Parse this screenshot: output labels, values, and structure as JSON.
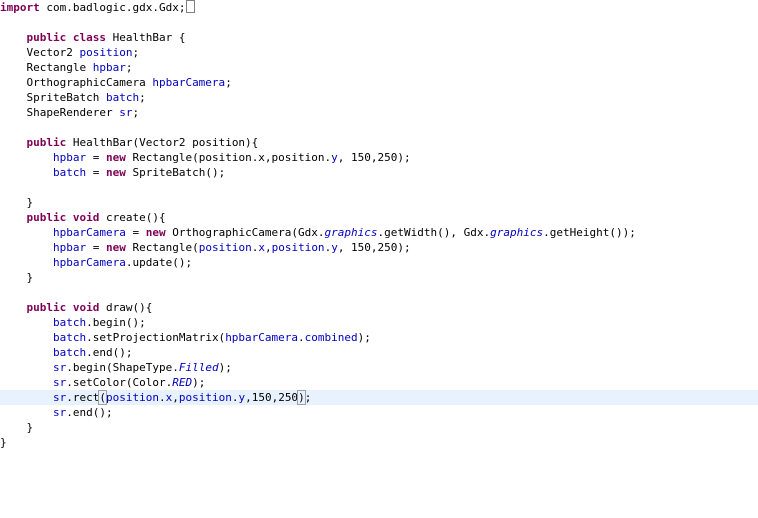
{
  "editor": {
    "current_line_index": 26,
    "lines": [
      [
        {
          "t": "kw",
          "v": "import"
        },
        {
          "t": "plain",
          "v": " com.badlogic.gdx.Gdx;"
        },
        {
          "t": "caret",
          "v": ""
        }
      ],
      [],
      [
        {
          "t": "plain",
          "v": "    "
        },
        {
          "t": "kw",
          "v": "public"
        },
        {
          "t": "plain",
          "v": " "
        },
        {
          "t": "kw",
          "v": "class"
        },
        {
          "t": "plain",
          "v": " HealthBar {"
        }
      ],
      [
        {
          "t": "plain",
          "v": "    Vector2 "
        },
        {
          "t": "field",
          "v": "position"
        },
        {
          "t": "plain",
          "v": ";"
        }
      ],
      [
        {
          "t": "plain",
          "v": "    Rectangle "
        },
        {
          "t": "field",
          "v": "hpbar"
        },
        {
          "t": "plain",
          "v": ";"
        }
      ],
      [
        {
          "t": "plain",
          "v": "    OrthographicCamera "
        },
        {
          "t": "field",
          "v": "hpbarCamera"
        },
        {
          "t": "plain",
          "v": ";"
        }
      ],
      [
        {
          "t": "plain",
          "v": "    SpriteBatch "
        },
        {
          "t": "field",
          "v": "batch"
        },
        {
          "t": "plain",
          "v": ";"
        }
      ],
      [
        {
          "t": "plain",
          "v": "    ShapeRenderer "
        },
        {
          "t": "field",
          "v": "sr"
        },
        {
          "t": "plain",
          "v": ";"
        }
      ],
      [],
      [
        {
          "t": "plain",
          "v": "    "
        },
        {
          "t": "kw",
          "v": "public"
        },
        {
          "t": "plain",
          "v": " HealthBar(Vector2 position){"
        }
      ],
      [
        {
          "t": "plain",
          "v": "        "
        },
        {
          "t": "field",
          "v": "hpbar"
        },
        {
          "t": "plain",
          "v": " = "
        },
        {
          "t": "kw",
          "v": "new"
        },
        {
          "t": "plain",
          "v": " Rectangle(position.x,position."
        },
        {
          "t": "field",
          "v": "y"
        },
        {
          "t": "plain",
          "v": ", 150,250);"
        }
      ],
      [
        {
          "t": "plain",
          "v": "        "
        },
        {
          "t": "field",
          "v": "batch"
        },
        {
          "t": "plain",
          "v": " = "
        },
        {
          "t": "kw",
          "v": "new"
        },
        {
          "t": "plain",
          "v": " SpriteBatch();"
        }
      ],
      [],
      [
        {
          "t": "plain",
          "v": "    }"
        }
      ],
      [
        {
          "t": "plain",
          "v": "    "
        },
        {
          "t": "kw",
          "v": "public"
        },
        {
          "t": "plain",
          "v": " "
        },
        {
          "t": "kw",
          "v": "void"
        },
        {
          "t": "plain",
          "v": " create(){"
        }
      ],
      [
        {
          "t": "plain",
          "v": "        "
        },
        {
          "t": "field",
          "v": "hpbarCamera"
        },
        {
          "t": "plain",
          "v": " = "
        },
        {
          "t": "kw",
          "v": "new"
        },
        {
          "t": "plain",
          "v": " OrthographicCamera(Gdx."
        },
        {
          "t": "static",
          "v": "graphics"
        },
        {
          "t": "plain",
          "v": ".getWidth(), Gdx."
        },
        {
          "t": "static",
          "v": "graphics"
        },
        {
          "t": "plain",
          "v": ".getHeight());"
        }
      ],
      [
        {
          "t": "plain",
          "v": "        "
        },
        {
          "t": "field",
          "v": "hpbar"
        },
        {
          "t": "plain",
          "v": " = "
        },
        {
          "t": "kw",
          "v": "new"
        },
        {
          "t": "plain",
          "v": " Rectangle("
        },
        {
          "t": "field",
          "v": "position"
        },
        {
          "t": "plain",
          "v": "."
        },
        {
          "t": "field",
          "v": "x"
        },
        {
          "t": "plain",
          "v": ","
        },
        {
          "t": "field",
          "v": "position"
        },
        {
          "t": "plain",
          "v": "."
        },
        {
          "t": "field",
          "v": "y"
        },
        {
          "t": "plain",
          "v": ", 150,250);"
        }
      ],
      [
        {
          "t": "plain",
          "v": "        "
        },
        {
          "t": "field",
          "v": "hpbarCamera"
        },
        {
          "t": "plain",
          "v": ".update();"
        }
      ],
      [
        {
          "t": "plain",
          "v": "    }"
        }
      ],
      [],
      [
        {
          "t": "plain",
          "v": "    "
        },
        {
          "t": "kw",
          "v": "public"
        },
        {
          "t": "plain",
          "v": " "
        },
        {
          "t": "kw",
          "v": "void"
        },
        {
          "t": "plain",
          "v": " draw(){"
        }
      ],
      [
        {
          "t": "plain",
          "v": "        "
        },
        {
          "t": "field",
          "v": "batch"
        },
        {
          "t": "plain",
          "v": ".begin();"
        }
      ],
      [
        {
          "t": "plain",
          "v": "        "
        },
        {
          "t": "field",
          "v": "batch"
        },
        {
          "t": "plain",
          "v": ".setProjectionMatrix("
        },
        {
          "t": "field",
          "v": "hpbarCamera"
        },
        {
          "t": "plain",
          "v": "."
        },
        {
          "t": "field",
          "v": "combined"
        },
        {
          "t": "plain",
          "v": ");"
        }
      ],
      [
        {
          "t": "plain",
          "v": "        "
        },
        {
          "t": "field",
          "v": "batch"
        },
        {
          "t": "plain",
          "v": ".end();"
        }
      ],
      [
        {
          "t": "plain",
          "v": "        "
        },
        {
          "t": "field",
          "v": "sr"
        },
        {
          "t": "plain",
          "v": ".begin(ShapeType."
        },
        {
          "t": "static",
          "v": "Filled"
        },
        {
          "t": "plain",
          "v": ");"
        }
      ],
      [
        {
          "t": "plain",
          "v": "        "
        },
        {
          "t": "field",
          "v": "sr"
        },
        {
          "t": "plain",
          "v": ".setColor(Color."
        },
        {
          "t": "static",
          "v": "RED"
        },
        {
          "t": "plain",
          "v": ");"
        }
      ],
      [
        {
          "t": "plain",
          "v": "        "
        },
        {
          "t": "field",
          "v": "sr"
        },
        {
          "t": "plain",
          "v": ".rect"
        },
        {
          "t": "paren",
          "v": "("
        },
        {
          "t": "field",
          "v": "position"
        },
        {
          "t": "plain",
          "v": "."
        },
        {
          "t": "field",
          "v": "x"
        },
        {
          "t": "plain",
          "v": ","
        },
        {
          "t": "field",
          "v": "position"
        },
        {
          "t": "plain",
          "v": "."
        },
        {
          "t": "field",
          "v": "y"
        },
        {
          "t": "plain",
          "v": ",150,250"
        },
        {
          "t": "paren",
          "v": ")"
        },
        {
          "t": "plain",
          "v": ";"
        }
      ],
      [
        {
          "t": "plain",
          "v": "        "
        },
        {
          "t": "field",
          "v": "sr"
        },
        {
          "t": "plain",
          "v": ".end();"
        }
      ],
      [
        {
          "t": "plain",
          "v": "    }"
        }
      ],
      [
        {
          "t": "plain",
          "v": "}"
        }
      ]
    ]
  },
  "colors": {
    "keyword": "#7f0055",
    "field": "#0000c0",
    "current_line": "#e8f2fe",
    "background": "#ffffff"
  }
}
